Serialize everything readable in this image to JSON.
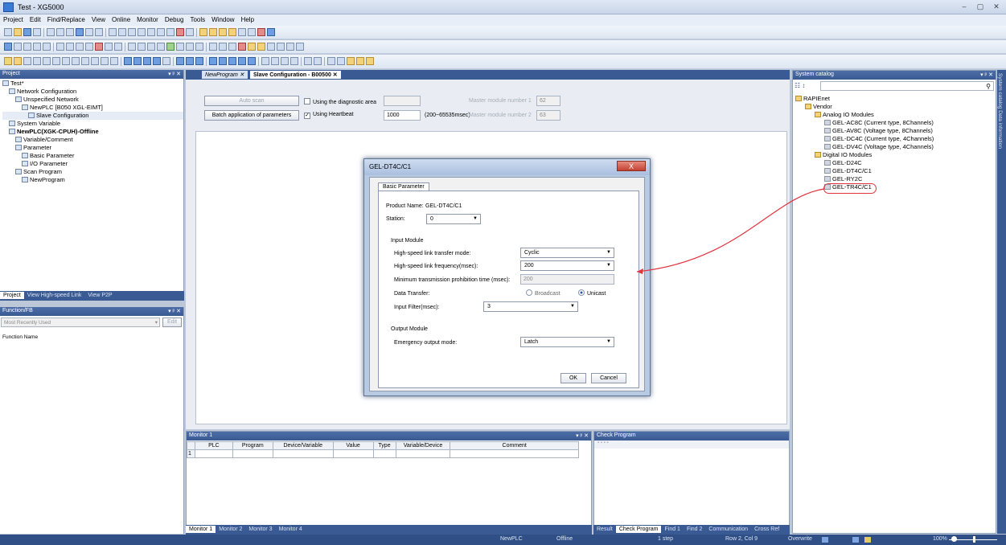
{
  "window": {
    "title": "Test - XG5000"
  },
  "menu": [
    "Project",
    "Edit",
    "Find/Replace",
    "View",
    "Online",
    "Monitor",
    "Debug",
    "Tools",
    "Window",
    "Help"
  ],
  "project_panel": {
    "title": "Project",
    "tree": [
      {
        "label": "Test*",
        "level": 0,
        "bold": false
      },
      {
        "label": "Network Configuration",
        "level": 1,
        "bold": false
      },
      {
        "label": "Unspecified Network",
        "level": 2,
        "bold": false
      },
      {
        "label": "NewPLC [B050 XGL-EIMT]",
        "level": 3,
        "bold": false
      },
      {
        "label": "Slave Configuration",
        "level": 4,
        "bold": false
      },
      {
        "label": "System Variable",
        "level": 1,
        "bold": false
      },
      {
        "label": "NewPLC(XGK-CPUH)-Offline",
        "level": 1,
        "bold": true
      },
      {
        "label": "Variable/Comment",
        "level": 2,
        "bold": false
      },
      {
        "label": "Parameter",
        "level": 2,
        "bold": false
      },
      {
        "label": "Basic Parameter",
        "level": 3,
        "bold": false
      },
      {
        "label": "I/O Parameter",
        "level": 3,
        "bold": false
      },
      {
        "label": "Scan Program",
        "level": 2,
        "bold": false
      },
      {
        "label": "NewProgram",
        "level": 3,
        "bold": false
      }
    ],
    "tabs": [
      "Project",
      "View High-speed Link",
      "View P2P"
    ]
  },
  "function_panel": {
    "title": "Function/FB",
    "combo": "Most Recently Used",
    "edit_label": "Edit",
    "column": "Function Name"
  },
  "doc_tabs": [
    "NewProgram",
    "Slave Configuration - B00500"
  ],
  "slave_config": {
    "auto_scan": "Auto scan",
    "batch": "Batch application of parameters",
    "use_diag": "Using the diagnostic area",
    "use_heartbeat": "Using Heartbeat",
    "heartbeat_value": "1000",
    "heartbeat_range": "(200~65535msec)",
    "master_module_1": "Master module number 1",
    "master_module_1_value": "62",
    "master_module_2": "Master module number 2",
    "master_module_2_value": "63"
  },
  "dialog": {
    "title": "GEL-DT4C/C1",
    "close": "X",
    "tab": "Basic Parameter",
    "product_name_label": "Product Name:",
    "product_name": "GEL-DT4C/C1",
    "station_label": "Station:",
    "station_value": "0",
    "input_module": "Input Module",
    "hs_mode_label": "High-speed link transfer mode:",
    "hs_mode_value": "Cyclic",
    "hs_freq_label": "High-speed link frequency(msec):",
    "hs_freq_value": "200",
    "min_tx_label": "Minimum transmission prohibition time (msec):",
    "min_tx_value": "200",
    "data_transfer_label": "Data Transfer:",
    "broadcast": "Broadcast",
    "unicast": "Unicast",
    "input_filter_label": "Input Filter(msec):",
    "input_filter_value": "3",
    "output_module": "Output Module",
    "emergency_label": "Emergency output mode:",
    "emergency_value": "Latch",
    "ok": "OK",
    "cancel": "Cancel"
  },
  "monitor": {
    "title": "Monitor 1",
    "columns": [
      "PLC",
      "Program",
      "Device/Variable",
      "Value",
      "Type",
      "Variable/Device",
      "Comment"
    ],
    "row_num": "1",
    "tabs": [
      "Monitor 1",
      "Monitor 2",
      "Monitor 3",
      "Monitor 4"
    ]
  },
  "check_program": {
    "title": "Check Program",
    "tabs": [
      "Result",
      "Check Program",
      "Find 1",
      "Find 2",
      "Communication",
      "Cross Ref"
    ]
  },
  "catalog": {
    "title": "System catalog",
    "side_tabs": "System catalog  Data information",
    "tree": [
      {
        "label": "RAPIEnet",
        "level": 0,
        "type": "folder"
      },
      {
        "label": "Vendor",
        "level": 1,
        "type": "folder"
      },
      {
        "label": "Analog IO Modules",
        "level": 2,
        "type": "folder"
      },
      {
        "label": "GEL-AC8C (Current type, 8Channels)",
        "level": 3,
        "type": "mod"
      },
      {
        "label": "GEL-AV8C (Voltage type, 8Channels)",
        "level": 3,
        "type": "mod"
      },
      {
        "label": "GEL-DC4C (Current type, 4Channels)",
        "level": 3,
        "type": "mod"
      },
      {
        "label": "GEL-DV4C (Voltage type, 4Channels)",
        "level": 3,
        "type": "mod"
      },
      {
        "label": "Digital IO Modules",
        "level": 2,
        "type": "folder"
      },
      {
        "label": "GEL-D24C",
        "level": 3,
        "type": "mod"
      },
      {
        "label": "GEL-DT4C/C1",
        "level": 3,
        "type": "mod"
      },
      {
        "label": "GEL-RY2C",
        "level": 3,
        "type": "mod"
      },
      {
        "label": "GEL-TR4C/C1",
        "level": 3,
        "type": "mod"
      }
    ]
  },
  "status": {
    "plc": "NewPLC",
    "mode": "Offline",
    "step": "1 step",
    "pos": "Row 2, Col 9",
    "overwrite": "Overwrite",
    "zoom": "100%"
  },
  "colors": {
    "accent": "#3a5a94",
    "annotation": "#e0343f"
  }
}
